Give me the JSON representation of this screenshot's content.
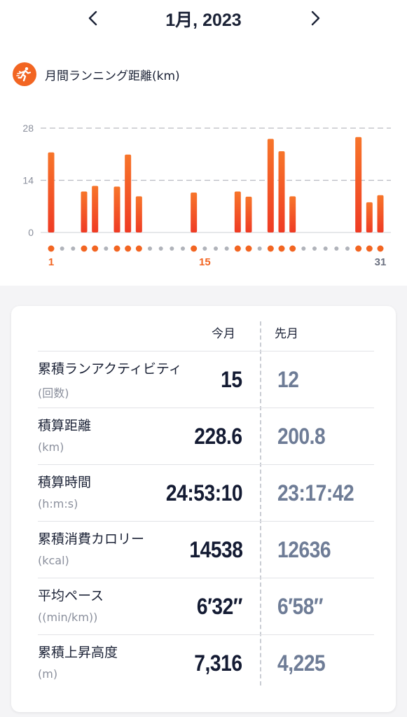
{
  "header": {
    "month": "1月, 2023"
  },
  "chart_section": {
    "label": "月間ランニング距離(km)"
  },
  "chart_data": {
    "type": "bar",
    "title": "月間ランニング距離(km)",
    "x": [
      1,
      2,
      3,
      4,
      5,
      6,
      7,
      8,
      9,
      10,
      11,
      12,
      13,
      14,
      15,
      16,
      17,
      18,
      19,
      20,
      21,
      22,
      23,
      24,
      25,
      26,
      27,
      28,
      29,
      30,
      31
    ],
    "values": [
      21.5,
      0,
      0,
      11,
      12.5,
      0,
      12.3,
      20.9,
      9.7,
      0,
      0,
      0,
      0,
      10.7,
      0,
      0,
      0,
      11,
      9.6,
      0,
      25.1,
      21.8,
      9.7,
      0,
      0,
      0,
      0,
      0,
      25.6,
      8.1,
      10
    ],
    "ylim": [
      0,
      28
    ],
    "yticks": [
      0,
      14,
      28
    ],
    "xtick_labels": [
      "1",
      "15",
      "31"
    ],
    "highlighted_xtick_labels": [
      "1",
      "15"
    ],
    "grid": true,
    "bar_color": "#f4511e",
    "active_dot_color": "#f26522",
    "inactive_dot_color": "#b0b3ba"
  },
  "stats": {
    "col_current": "今月",
    "col_previous": "先月",
    "rows": [
      {
        "title": "累積ランアクティビティ",
        "unit": "(回数)",
        "current": "15",
        "previous": "12"
      },
      {
        "title": "積算距離",
        "unit": "(km)",
        "current": "228.6",
        "previous": "200.8"
      },
      {
        "title": "積算時間",
        "unit": "(h:m:s)",
        "current": "24:53:10",
        "previous": "23:17:42"
      },
      {
        "title": "累積消費カロリー",
        "unit": "(kcal)",
        "current": "14538",
        "previous": "12636"
      },
      {
        "title": "平均ペース",
        "unit": "((min/km))",
        "current": "6′32″",
        "previous": "6′58″"
      },
      {
        "title": "累積上昇高度",
        "unit": "(m)",
        "current": "7,316",
        "previous": "4,225"
      }
    ]
  }
}
